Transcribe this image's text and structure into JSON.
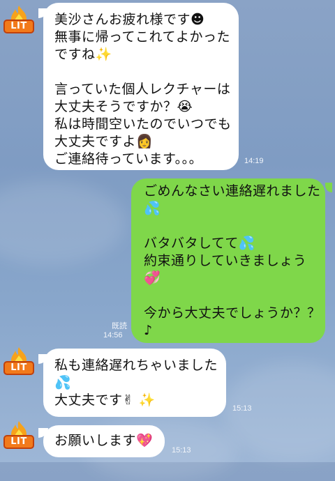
{
  "messages": [
    {
      "side": "in",
      "avatar_badge": "LIT",
      "lines": [
        "美沙さんお疲れ様です☻",
        "無事に帰ってこれてよかった",
        "ですね✨",
        "",
        "言っていた個人レクチャーは",
        "大丈夫そうですか？😭",
        "私は時間空いたのでいつでも",
        "大丈夫ですよ👩",
        "ご連絡待っています。。。"
      ],
      "time": "14:19"
    },
    {
      "side": "out",
      "lines": [
        "ごめんなさい連絡遅れました",
        "💦",
        "",
        "バタバタしてて💦",
        "約束通りしていきましょう",
        "💞",
        "",
        "今から大丈夫でしょうか？？",
        "♪"
      ],
      "read": "既読",
      "time": "14:56"
    },
    {
      "side": "in",
      "avatar_badge": "LIT",
      "lines": [
        "私も連絡遅れちゃいました",
        "💦",
        "大丈夫です✌ ✨"
      ],
      "time": "15:13"
    },
    {
      "side": "in",
      "avatar_badge": "LIT",
      "lines": [
        "お願いします💖"
      ],
      "time": "15:13"
    }
  ],
  "colors": {
    "incoming_bubble": "#ffffff",
    "outgoing_bubble": "#7fd74a",
    "background": "#8aa3c6"
  },
  "icons": {
    "avatar": "fire-lit-icon"
  }
}
